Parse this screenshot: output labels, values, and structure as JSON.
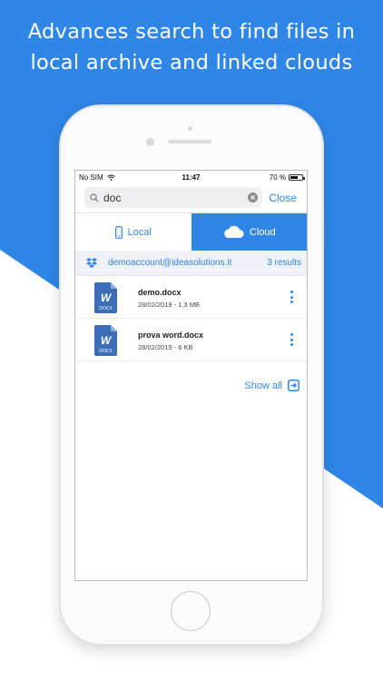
{
  "headline": {
    "line1": "Advances search to find files in",
    "line2": "local archive and linked clouds"
  },
  "status": {
    "carrier": "No SIM",
    "time": "11:47",
    "battery_text": "70 %",
    "battery_level": 0.7
  },
  "search": {
    "value": "doc",
    "close_label": "Close"
  },
  "tabs": [
    {
      "label": "Local",
      "icon": "phone-icon",
      "selected": false
    },
    {
      "label": "Cloud",
      "icon": "cloud-icon",
      "selected": true
    }
  ],
  "account": {
    "service_icon": "dropbox-icon",
    "email": "demoaccount@ideasolutions.it",
    "results": "3 results"
  },
  "files": [
    {
      "name": "demo.docx",
      "meta": "28/02/2019 - 1,3 MB",
      "icon_letter": "W",
      "icon_label": "DOCX"
    },
    {
      "name": "prova word.docx",
      "meta": "28/02/2019 - 6 KB",
      "icon_letter": "W",
      "icon_label": "DOCX"
    }
  ],
  "show_all_label": "Show all",
  "colors": {
    "accent": "#2f86e6",
    "docx_icon": "#3a6fb8"
  }
}
